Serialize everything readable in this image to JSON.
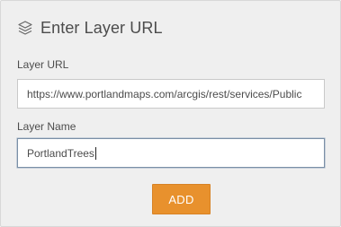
{
  "dialog": {
    "title": "Enter Layer URL",
    "icon": "layers-icon"
  },
  "layer_url": {
    "label": "Layer URL",
    "value": "https://www.portlandmaps.com/arcgis/rest/services/Public"
  },
  "layer_name": {
    "label": "Layer Name",
    "value": "PortlandTrees"
  },
  "actions": {
    "add_label": "ADD"
  },
  "colors": {
    "accent": "#e8912d",
    "panel_background": "#efefef",
    "text": "#4c4c4c"
  }
}
